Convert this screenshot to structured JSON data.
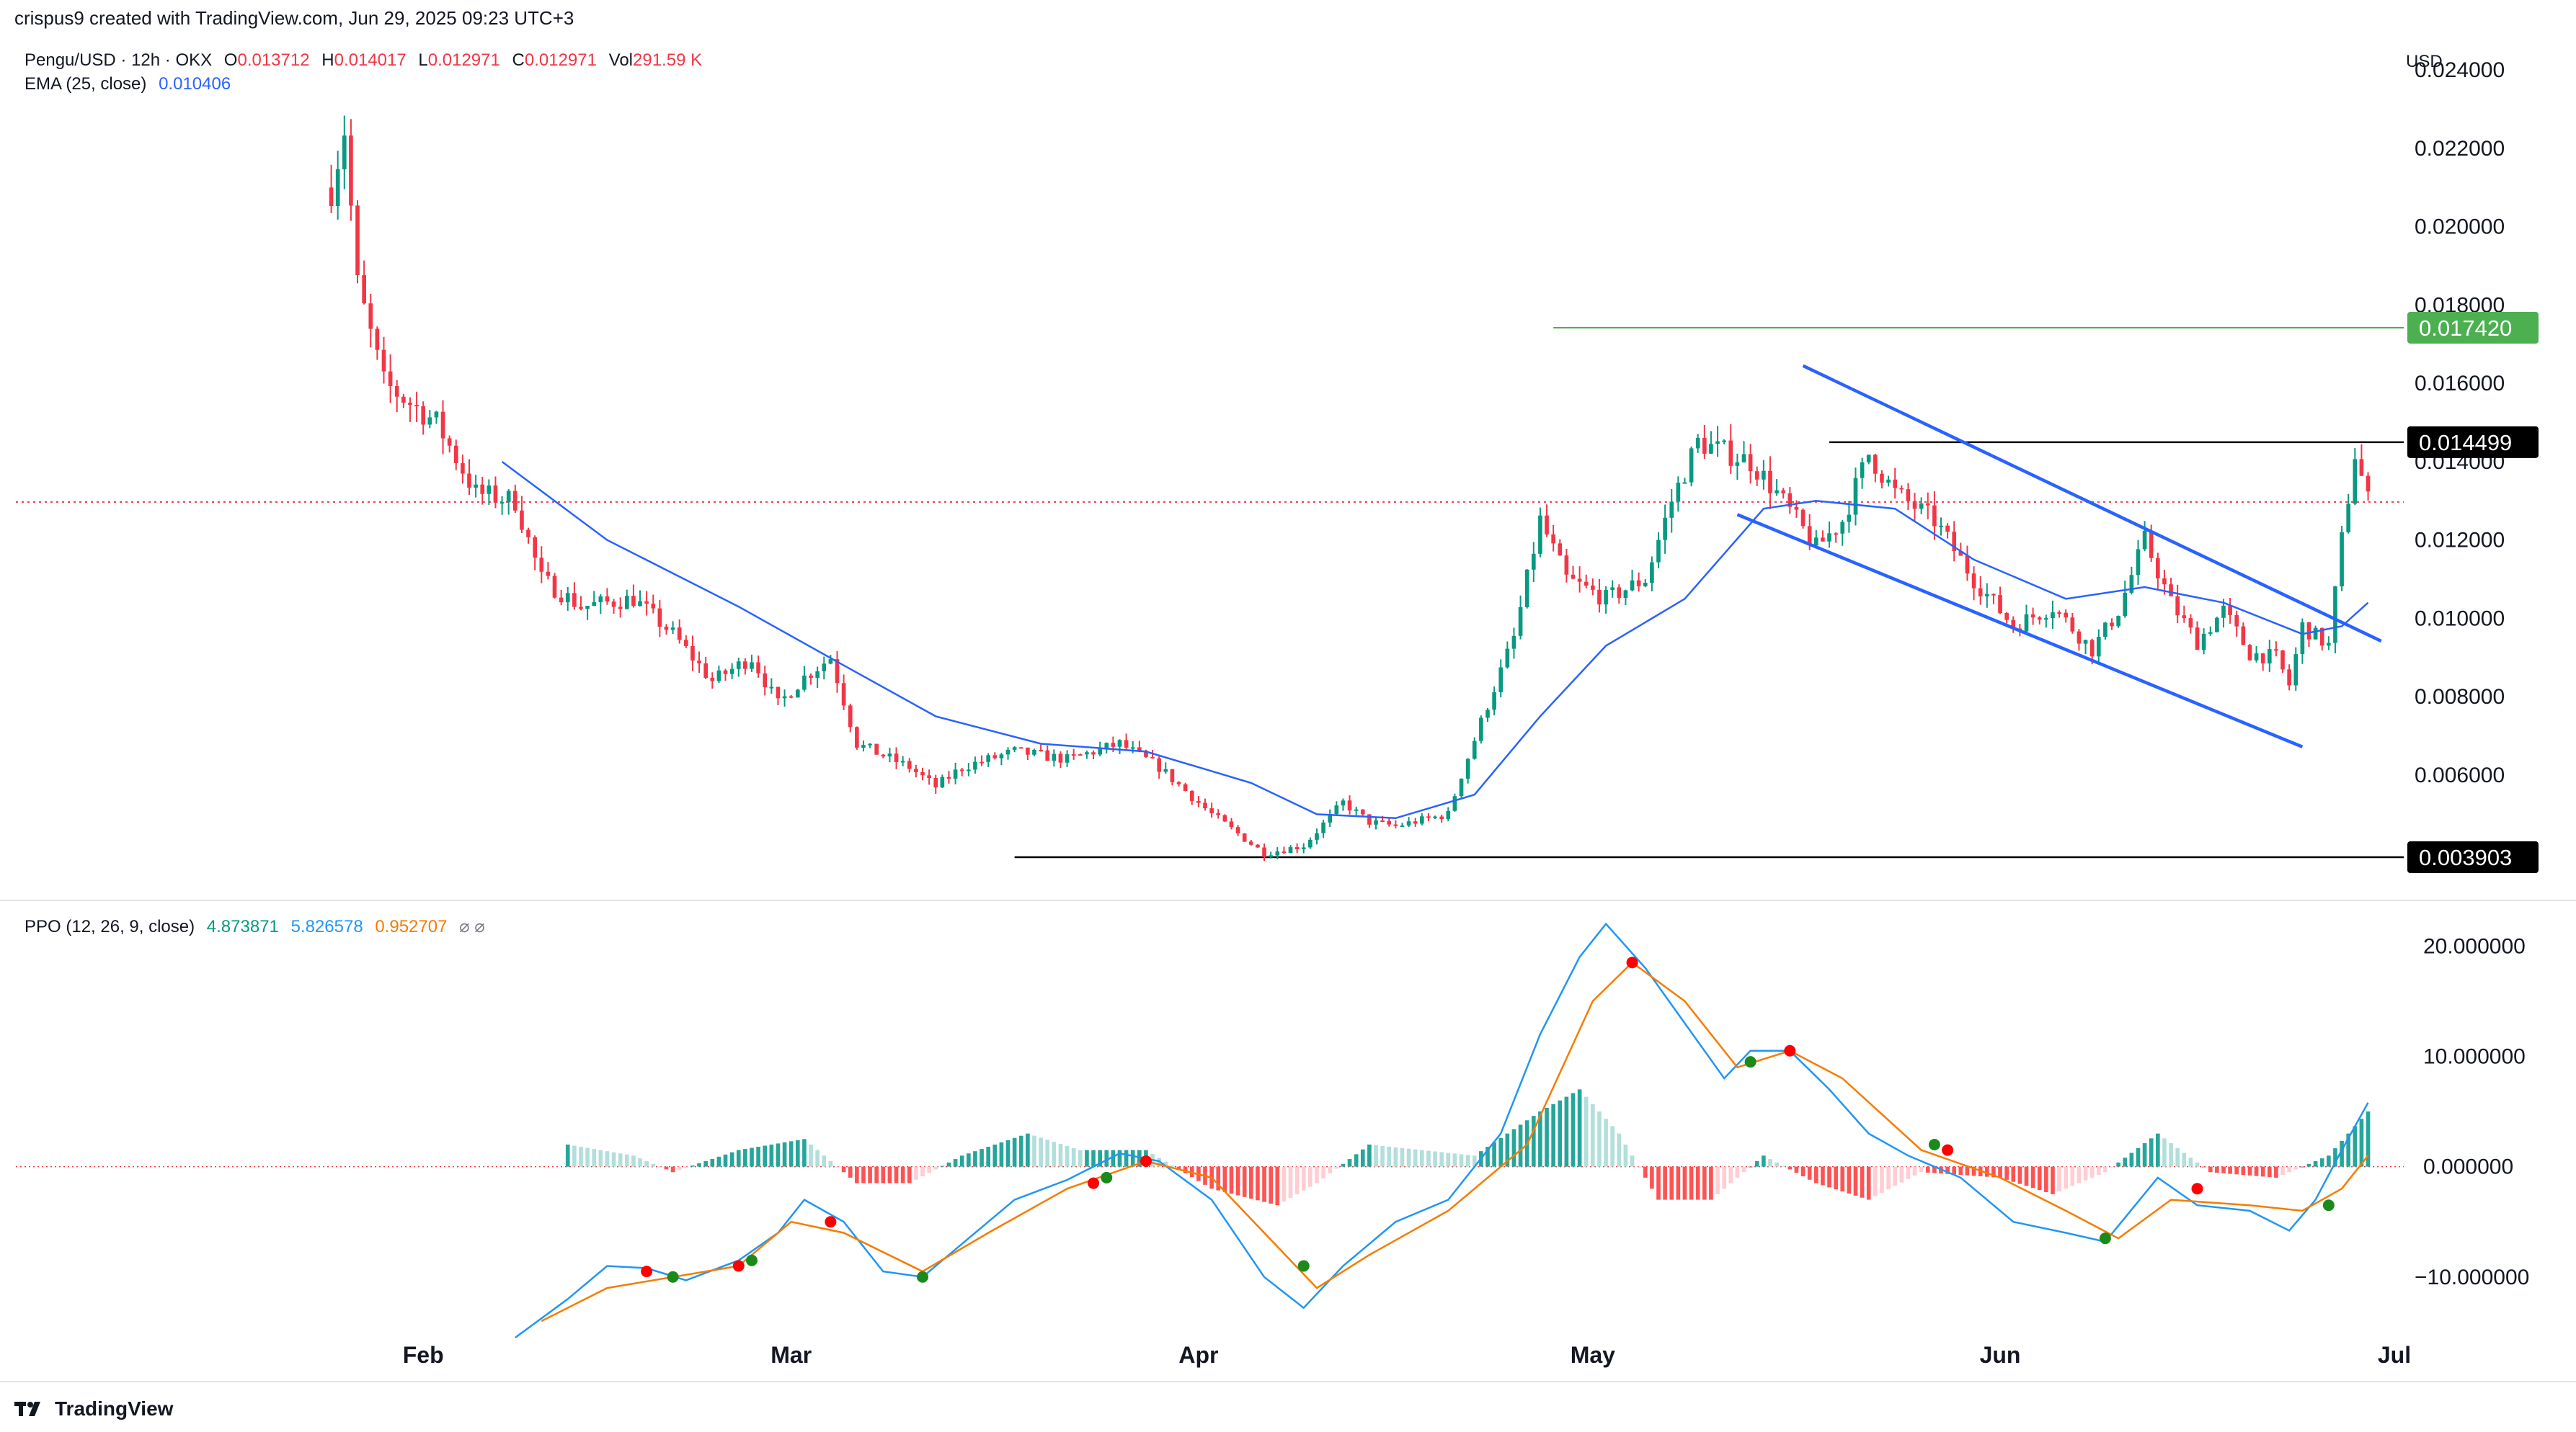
{
  "header": {
    "creator_text": "crispus9 created with TradingView.com, Jun 29, 2025 09:23 UTC+3"
  },
  "footer": {
    "brand": "TradingView"
  },
  "currency": "USD",
  "legend_main": {
    "symbol": "Pengu/USD · 12h · OKX",
    "o_label": "O",
    "o_value": "0.013712",
    "h_label": "H",
    "h_value": "0.014017",
    "l_label": "L",
    "l_value": "0.012971",
    "c_label": "C",
    "c_value": "0.012971",
    "vol_label": "Vol",
    "vol_value": "291.59 K"
  },
  "legend_ema": {
    "label": "EMA (25, close)",
    "value": "0.010406"
  },
  "legend_ppo": {
    "label": "PPO (12, 26, 9, close)",
    "v1": "4.873871",
    "v2": "5.826578",
    "v3": "0.952707",
    "icons": "⌀ ⌀"
  },
  "colors": {
    "up": "#089981",
    "up_ppo_bar": "#26a69a",
    "down": "#f23645",
    "ema": "#2962ff",
    "ppo_line": "#2196f3",
    "signal_line": "#f57c00",
    "channel": "#2962ff",
    "resistance_green": "#4caf50",
    "label_green": "#4caf50",
    "label_black": "#000000"
  },
  "chart_data": [
    {
      "type": "candlestick",
      "x_axis_labels": [
        "Feb",
        "Mar",
        "Apr",
        "May",
        "Jun",
        "Jul"
      ],
      "y_ticks": [
        "0.024000",
        "0.022000",
        "0.020000",
        "0.018000",
        "0.016000",
        "0.014000",
        "0.012000",
        "0.010000",
        "0.008000",
        "0.006000"
      ],
      "ylim": [
        0.0028,
        0.0245
      ],
      "price_labels": [
        {
          "value": "0.017420",
          "style": "green"
        },
        {
          "value": "0.014499",
          "style": "black"
        },
        {
          "value": "0.003903",
          "style": "black"
        }
      ],
      "horizontal_lines": [
        {
          "value": 0.01742,
          "from": "2025-04-28",
          "to": "2025-06-29",
          "color": "green"
        },
        {
          "value": 0.014499,
          "from": "2025-05-19",
          "to": "2025-06-29",
          "color": "black"
        },
        {
          "value": 0.003903,
          "from": "2025-03-18",
          "to": "2025-06-29",
          "color": "black"
        },
        {
          "value": 0.012971,
          "from": "2025-01-01",
          "to": "2025-06-29",
          "color": "red-dotted"
        }
      ],
      "channel_lines": [
        {
          "from": [
            "2025-05-17",
            0.01645
          ],
          "to": [
            "2025-06-30",
            0.00942
          ]
        },
        {
          "from": [
            "2025-05-12",
            0.01265
          ],
          "to": [
            "2025-06-24",
            0.00672
          ]
        }
      ],
      "series": [
        {
          "name": "Pengu/USD",
          "anchor_points": [
            [
              "2025-01-25",
              0.021
            ],
            [
              "2025-01-26",
              0.0225
            ],
            [
              "2025-01-27",
              0.0185
            ],
            [
              "2025-01-29",
              0.016
            ],
            [
              "2025-02-02",
              0.015
            ],
            [
              "2025-02-05",
              0.0132
            ],
            [
              "2025-02-08",
              0.013
            ],
            [
              "2025-02-10",
              0.011
            ],
            [
              "2025-02-13",
              0.0103
            ],
            [
              "2025-02-17",
              0.0105
            ],
            [
              "2025-02-20",
              0.0096
            ],
            [
              "2025-02-23",
              0.0084
            ],
            [
              "2025-02-26",
              0.009
            ],
            [
              "2025-02-28",
              0.0078
            ],
            [
              "2025-03-02",
              0.0085
            ],
            [
              "2025-03-04",
              0.009
            ],
            [
              "2025-03-06",
              0.0068
            ],
            [
              "2025-03-10",
              0.0062
            ],
            [
              "2025-03-12",
              0.0057
            ],
            [
              "2025-03-14",
              0.0062
            ],
            [
              "2025-03-18",
              0.0066
            ],
            [
              "2025-03-22",
              0.0064
            ],
            [
              "2025-03-26",
              0.0068
            ],
            [
              "2025-03-29",
              0.0062
            ],
            [
              "2025-04-02",
              0.005
            ],
            [
              "2025-04-06",
              0.004
            ],
            [
              "2025-04-09",
              0.0042
            ],
            [
              "2025-04-12",
              0.0053
            ],
            [
              "2025-04-14",
              0.0048
            ],
            [
              "2025-04-16",
              0.0047
            ],
            [
              "2025-04-20",
              0.005
            ],
            [
              "2025-04-21",
              0.006
            ],
            [
              "2025-04-23",
              0.0078
            ],
            [
              "2025-04-25",
              0.0095
            ],
            [
              "2025-04-27",
              0.0125
            ],
            [
              "2025-04-29",
              0.011
            ],
            [
              "2025-05-02",
              0.0105
            ],
            [
              "2025-05-05",
              0.011
            ],
            [
              "2025-05-07",
              0.013
            ],
            [
              "2025-05-09",
              0.0145
            ],
            [
              "2025-05-13",
              0.014
            ],
            [
              "2025-05-15",
              0.0132
            ],
            [
              "2025-05-18",
              0.0118
            ],
            [
              "2025-05-20",
              0.0125
            ],
            [
              "2025-05-22",
              0.0142
            ],
            [
              "2025-05-24",
              0.0132
            ],
            [
              "2025-05-27",
              0.0125
            ],
            [
              "2025-05-30",
              0.011
            ],
            [
              "2025-06-02",
              0.0098
            ],
            [
              "2025-06-05",
              0.0103
            ],
            [
              "2025-06-08",
              0.0092
            ],
            [
              "2025-06-10",
              0.0102
            ],
            [
              "2025-06-12",
              0.012
            ],
            [
              "2025-06-14",
              0.0104
            ],
            [
              "2025-06-16",
              0.0094
            ],
            [
              "2025-06-18",
              0.0102
            ],
            [
              "2025-06-20",
              0.0091
            ],
            [
              "2025-06-22",
              0.009
            ],
            [
              "2025-06-23",
              0.0083
            ],
            [
              "2025-06-24",
              0.0098
            ],
            [
              "2025-06-26",
              0.0093
            ],
            [
              "2025-06-27",
              0.012
            ],
            [
              "2025-06-28",
              0.0142
            ],
            [
              "2025-06-29",
              0.013
            ]
          ]
        },
        {
          "name": "EMA (25, close)",
          "anchor_points": [
            [
              "2025-02-07",
              0.014
            ],
            [
              "2025-02-15",
              0.012
            ],
            [
              "2025-02-25",
              0.0103
            ],
            [
              "2025-03-05",
              0.0088
            ],
            [
              "2025-03-12",
              0.0075
            ],
            [
              "2025-03-20",
              0.0068
            ],
            [
              "2025-03-28",
              0.0066
            ],
            [
              "2025-04-05",
              0.0058
            ],
            [
              "2025-04-10",
              0.005
            ],
            [
              "2025-04-16",
              0.0049
            ],
            [
              "2025-04-22",
              0.0055
            ],
            [
              "2025-04-27",
              0.0075
            ],
            [
              "2025-05-02",
              0.0093
            ],
            [
              "2025-05-08",
              0.0105
            ],
            [
              "2025-05-14",
              0.0128
            ],
            [
              "2025-05-18",
              0.013
            ],
            [
              "2025-05-24",
              0.0128
            ],
            [
              "2025-05-30",
              0.0115
            ],
            [
              "2025-06-06",
              0.0105
            ],
            [
              "2025-06-12",
              0.0108
            ],
            [
              "2025-06-18",
              0.0104
            ],
            [
              "2025-06-24",
              0.0096
            ],
            [
              "2025-06-27",
              0.0098
            ],
            [
              "2025-06-29",
              0.0104
            ]
          ]
        }
      ]
    },
    {
      "type": "ppo",
      "y_ticks": [
        "20.000000",
        "10.000000",
        "0.000000",
        "−10.000000"
      ],
      "ylim": [
        -17,
        24
      ],
      "series": [
        {
          "name": "PPO",
          "anchor_points": [
            [
              "2025-02-08",
              -15.5
            ],
            [
              "2025-02-12",
              -12
            ],
            [
              "2025-02-15",
              -9
            ],
            [
              "2025-02-18",
              -9.2
            ],
            [
              "2025-02-21",
              -10.3
            ],
            [
              "2025-02-25",
              -8.5
            ],
            [
              "2025-02-28",
              -6
            ],
            [
              "2025-03-02",
              -3
            ],
            [
              "2025-03-05",
              -5
            ],
            [
              "2025-03-08",
              -9.5
            ],
            [
              "2025-03-11",
              -10
            ],
            [
              "2025-03-14",
              -7
            ],
            [
              "2025-03-18",
              -3
            ],
            [
              "2025-03-22",
              -1.2
            ],
            [
              "2025-03-26",
              1.2
            ],
            [
              "2025-03-29",
              0.5
            ],
            [
              "2025-04-02",
              -3
            ],
            [
              "2025-04-06",
              -10
            ],
            [
              "2025-04-09",
              -12.8
            ],
            [
              "2025-04-12",
              -9
            ],
            [
              "2025-04-16",
              -5
            ],
            [
              "2025-04-20",
              -3
            ],
            [
              "2025-04-24",
              3
            ],
            [
              "2025-04-27",
              12
            ],
            [
              "2025-04-30",
              19
            ],
            [
              "2025-05-02",
              22
            ],
            [
              "2025-05-05",
              18
            ],
            [
              "2025-05-08",
              13
            ],
            [
              "2025-05-11",
              8
            ],
            [
              "2025-05-13",
              10.5
            ],
            [
              "2025-05-16",
              10.5
            ],
            [
              "2025-05-19",
              7
            ],
            [
              "2025-05-22",
              3
            ],
            [
              "2025-05-25",
              1
            ],
            [
              "2025-05-29",
              -1
            ],
            [
              "2025-06-02",
              -5
            ],
            [
              "2025-06-06",
              -6
            ],
            [
              "2025-06-09",
              -6.8
            ],
            [
              "2025-06-13",
              -1
            ],
            [
              "2025-06-16",
              -3.5
            ],
            [
              "2025-06-20",
              -4
            ],
            [
              "2025-06-23",
              -5.8
            ],
            [
              "2025-06-25",
              -3
            ],
            [
              "2025-06-27",
              1.5
            ],
            [
              "2025-06-29",
              5.8
            ]
          ]
        },
        {
          "name": "Signal",
          "anchor_points": [
            [
              "2025-02-10",
              -14
            ],
            [
              "2025-02-15",
              -11
            ],
            [
              "2025-02-20",
              -10
            ],
            [
              "2025-02-25",
              -9
            ],
            [
              "2025-03-01",
              -5
            ],
            [
              "2025-03-05",
              -6
            ],
            [
              "2025-03-11",
              -9.5
            ],
            [
              "2025-03-16",
              -6
            ],
            [
              "2025-03-22",
              -2
            ],
            [
              "2025-03-28",
              0.5
            ],
            [
              "2025-04-02",
              -1
            ],
            [
              "2025-04-06",
              -6
            ],
            [
              "2025-04-10",
              -11
            ],
            [
              "2025-04-14",
              -8
            ],
            [
              "2025-04-20",
              -4
            ],
            [
              "2025-04-26",
              2
            ],
            [
              "2025-05-01",
              15
            ],
            [
              "2025-05-04",
              18.5
            ],
            [
              "2025-05-08",
              15
            ],
            [
              "2025-05-12",
              9
            ],
            [
              "2025-05-16",
              10.5
            ],
            [
              "2025-05-20",
              8
            ],
            [
              "2025-05-26",
              1.5
            ],
            [
              "2025-06-01",
              -1
            ],
            [
              "2025-06-06",
              -4
            ],
            [
              "2025-06-10",
              -6.5
            ],
            [
              "2025-06-14",
              -3
            ],
            [
              "2025-06-20",
              -3.5
            ],
            [
              "2025-06-24",
              -4
            ],
            [
              "2025-06-27",
              -2
            ],
            [
              "2025-06-29",
              1
            ]
          ]
        }
      ],
      "histogram_anchor_points": [
        [
          "2025-02-12",
          2
        ],
        [
          "2025-02-17",
          1
        ],
        [
          "2025-02-20",
          -0.5
        ],
        [
          "2025-02-25",
          1.5
        ],
        [
          "2025-03-02",
          2.5
        ],
        [
          "2025-03-06",
          -1.5
        ],
        [
          "2025-03-10",
          -1.5
        ],
        [
          "2025-03-14",
          1
        ],
        [
          "2025-03-19",
          3
        ],
        [
          "2025-03-23",
          1.5
        ],
        [
          "2025-03-28",
          1.5
        ],
        [
          "2025-04-02",
          -2
        ],
        [
          "2025-04-07",
          -3.5
        ],
        [
          "2025-04-10",
          -1.5
        ],
        [
          "2025-04-14",
          2
        ],
        [
          "2025-04-18",
          1.5
        ],
        [
          "2025-04-22",
          1
        ],
        [
          "2025-04-27",
          5
        ],
        [
          "2025-04-30",
          7
        ],
        [
          "2025-05-03",
          3
        ],
        [
          "2025-05-06",
          -3
        ],
        [
          "2025-05-10",
          -3
        ],
        [
          "2025-05-14",
          1
        ],
        [
          "2025-05-18",
          -1.5
        ],
        [
          "2025-05-22",
          -3
        ],
        [
          "2025-05-26",
          -0.5
        ],
        [
          "2025-06-01",
          -1
        ],
        [
          "2025-06-05",
          -2.5
        ],
        [
          "2025-06-09",
          -0.5
        ],
        [
          "2025-06-13",
          3
        ],
        [
          "2025-06-17",
          -0.5
        ],
        [
          "2025-06-22",
          -1
        ],
        [
          "2025-06-26",
          1
        ],
        [
          "2025-06-29",
          5
        ]
      ],
      "cross_markers": [
        {
          "date": "2025-02-18",
          "value": -9.5,
          "color": "red"
        },
        {
          "date": "2025-02-20",
          "value": -10,
          "color": "green"
        },
        {
          "date": "2025-02-25",
          "value": -9,
          "color": "red"
        },
        {
          "date": "2025-02-26",
          "value": -8.5,
          "color": "green"
        },
        {
          "date": "2025-03-04",
          "value": -5,
          "color": "red"
        },
        {
          "date": "2025-03-11",
          "value": -10,
          "color": "green"
        },
        {
          "date": "2025-03-24",
          "value": -1.5,
          "color": "red"
        },
        {
          "date": "2025-03-25",
          "value": -1,
          "color": "green"
        },
        {
          "date": "2025-03-28",
          "value": 0.5,
          "color": "red"
        },
        {
          "date": "2025-04-09",
          "value": -9,
          "color": "green"
        },
        {
          "date": "2025-05-04",
          "value": 18.5,
          "color": "red"
        },
        {
          "date": "2025-05-13",
          "value": 9.5,
          "color": "green"
        },
        {
          "date": "2025-05-16",
          "value": 10.5,
          "color": "red"
        },
        {
          "date": "2025-05-27",
          "value": 2,
          "color": "green"
        },
        {
          "date": "2025-05-28",
          "value": 1.5,
          "color": "red"
        },
        {
          "date": "2025-06-09",
          "value": -6.5,
          "color": "green"
        },
        {
          "date": "2025-06-16",
          "value": -2,
          "color": "red"
        },
        {
          "date": "2025-06-26",
          "value": -3.5,
          "color": "green"
        }
      ]
    }
  ]
}
